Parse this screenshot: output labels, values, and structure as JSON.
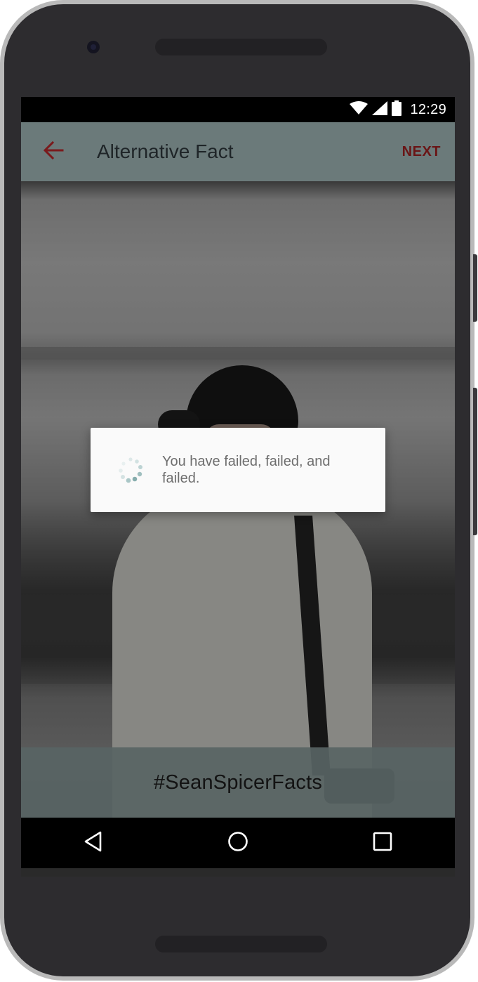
{
  "status_bar": {
    "time": "12:29",
    "icons": [
      "wifi-icon",
      "cell-signal-icon",
      "battery-icon"
    ]
  },
  "app_bar": {
    "back_icon": "arrow-left-icon",
    "title": "Alternative Fact",
    "next_label": "NEXT"
  },
  "dialog": {
    "message": "You have failed, failed, and failed.",
    "spinner_icon": "loading-spinner-icon"
  },
  "footer": {
    "hashtag": "#SeanSpicerFacts"
  },
  "nav_bar": {
    "back_icon": "nav-back-triangle-icon",
    "home_icon": "nav-home-circle-icon",
    "recents_icon": "nav-recents-square-icon"
  },
  "colors": {
    "app_bar_bg": "#6b7a7a",
    "accent": "#8a1a1c",
    "hashbar_bg": "#5a6565",
    "dialog_bg": "#fafafa",
    "dialog_text": "#6e6e6e"
  }
}
